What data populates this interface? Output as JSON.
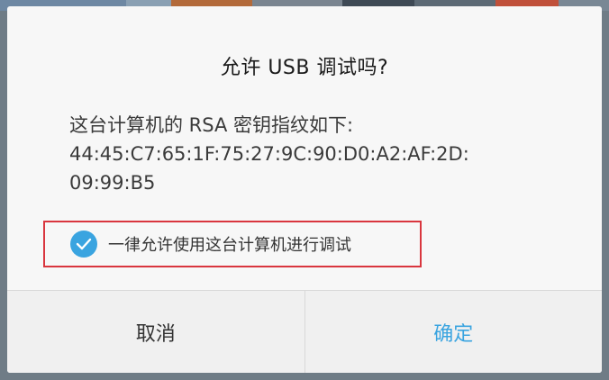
{
  "dialog": {
    "title": "允许 USB 调试吗?",
    "message_lines": [
      "这台计算机的 RSA 密钥指纹如下:",
      "44:45:C7:65:1F:75:27:9C:90:D0:A2:AF:2D:",
      "09:99:B5"
    ],
    "always_allow": {
      "label": "一律允许使用这台计算机进行调试",
      "checked": true
    },
    "cancel_label": "取消",
    "ok_label": "确定"
  },
  "colors": {
    "accent": "#3aa4e0",
    "highlight_border": "#d9363e",
    "dialog_background": "#f7f7f7"
  },
  "icons": {
    "checkbox": "checkmark-icon"
  }
}
